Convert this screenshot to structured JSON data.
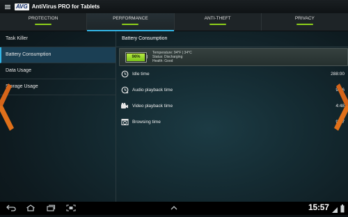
{
  "app": {
    "logo_text": "AVG",
    "title": "AntiVirus PRO for Tablets"
  },
  "tabs": [
    {
      "label": "PROTECTION",
      "active": false
    },
    {
      "label": "PERFORMANCE",
      "active": true
    },
    {
      "label": "ANTI-THEFT",
      "active": false
    },
    {
      "label": "PRIVACY",
      "active": false
    }
  ],
  "sidebar": {
    "items": [
      {
        "label": "Task Killer",
        "active": false
      },
      {
        "label": "Battery Consumption",
        "active": true
      },
      {
        "label": "Data Usage",
        "active": false
      },
      {
        "label": "Storage Usage",
        "active": false
      }
    ]
  },
  "main": {
    "title": "Battery Consumption",
    "battery": {
      "percent": "96%",
      "level": 0.96,
      "temperature": "Temperature: 94°F | 34°C",
      "status": "Status: Discharging",
      "health": "Health: Good"
    },
    "times": [
      {
        "label": "Idle time",
        "value": "288:00",
        "icon": "clock-icon"
      },
      {
        "label": "Audio playback time",
        "value": "9:36",
        "icon": "audio-playback-icon"
      },
      {
        "label": "Video playback time",
        "value": "4:48",
        "icon": "video-camera-icon"
      },
      {
        "label": "Browsing time",
        "value": "9:07",
        "icon": "browser-icon"
      }
    ]
  },
  "statusbar": {
    "clock": "15:57"
  },
  "colors": {
    "accent": "#33b5e5",
    "tab_indicator": "#8fd21a",
    "battery_fill": "#8ed321",
    "arrow_orange": "#e0701a"
  }
}
